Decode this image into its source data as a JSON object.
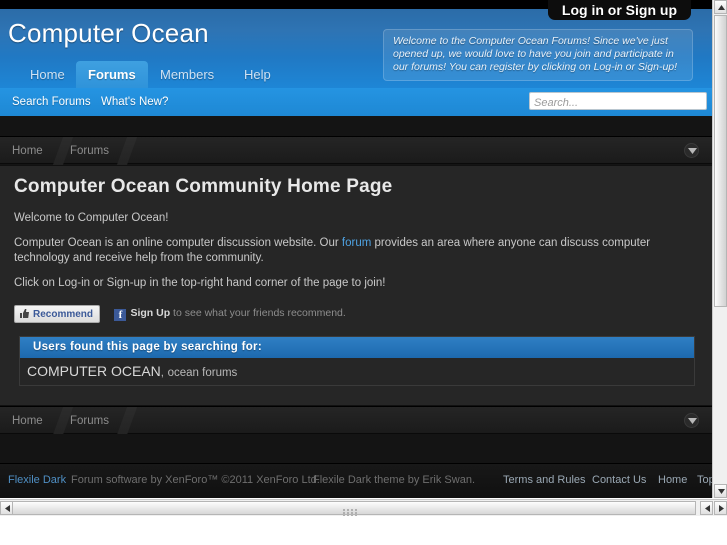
{
  "header": {
    "logo": "Computer Ocean",
    "login_button": "Log in or Sign up",
    "welcome_notice": "Welcome to the Computer Ocean Forums! Since we've just opened up, we would love to have you join and participate in our forums! You can register by clicking on Log-in or Sign-up!",
    "nav_tabs": [
      {
        "label": "Home",
        "selected": false
      },
      {
        "label": "Forums",
        "selected": true
      },
      {
        "label": "Members",
        "selected": false
      },
      {
        "label": "Help",
        "selected": false
      }
    ]
  },
  "subnav": {
    "links": [
      {
        "label": "Search Forums"
      },
      {
        "label": "What's New?"
      }
    ],
    "search_placeholder": "Search...",
    "search_value": ""
  },
  "breadcrumb_top": {
    "items": [
      {
        "label": "Home"
      },
      {
        "label": "Forums"
      }
    ],
    "toggle_icon": "chevron-down-icon"
  },
  "breadcrumb_bottom": {
    "items": [
      {
        "label": "Home"
      },
      {
        "label": "Forums"
      }
    ],
    "toggle_icon": "chevron-down-icon"
  },
  "main": {
    "page_title": "Computer Ocean Community Home Page",
    "paragraph_1": "Welcome to Computer Ocean!",
    "paragraph_2_before": "Computer Ocean is an online computer discussion website. Our ",
    "paragraph_2_link": "forum",
    "paragraph_2_after": " provides an area where anyone can discuss computer technology and receive help from the community.",
    "paragraph_3": "Click on Log-in or Sign-up in the top-right hand corner of the page to join!",
    "social": {
      "recommend_label": "Recommend",
      "recommend_icon": "thumbs-up-icon",
      "facebook_icon": "facebook-icon",
      "signup_label": "Sign Up",
      "signup_suffix": " to see what your friends recommend."
    },
    "search_terms": {
      "heading": "Users found this page by searching for:",
      "term_primary": "COMPUTER OCEAN",
      "term_separator": ",",
      "term_secondary": "ocean forums"
    }
  },
  "footer": {
    "theme_link": "Flexile Dark",
    "software_credit": "Forum software by XenForo™ ©2011 XenForo Ltd.",
    "theme_credit": "Flexile Dark theme by Erik Swan.",
    "links": [
      {
        "label": "Terms and Rules"
      },
      {
        "label": "Contact Us"
      },
      {
        "label": "Home"
      },
      {
        "label": "Top"
      }
    ]
  },
  "colors": {
    "brand_blue": "#1e86d6",
    "subnav_blue": "#1e88d4",
    "accent_bar": "#1d69ae",
    "panel_bg": "#262626",
    "page_bg": "#141414",
    "link_blue": "#4fa3e3"
  },
  "scrollbars": {
    "vertical": "vertical-scrollbar",
    "horizontal": "horizontal-scrollbar"
  }
}
